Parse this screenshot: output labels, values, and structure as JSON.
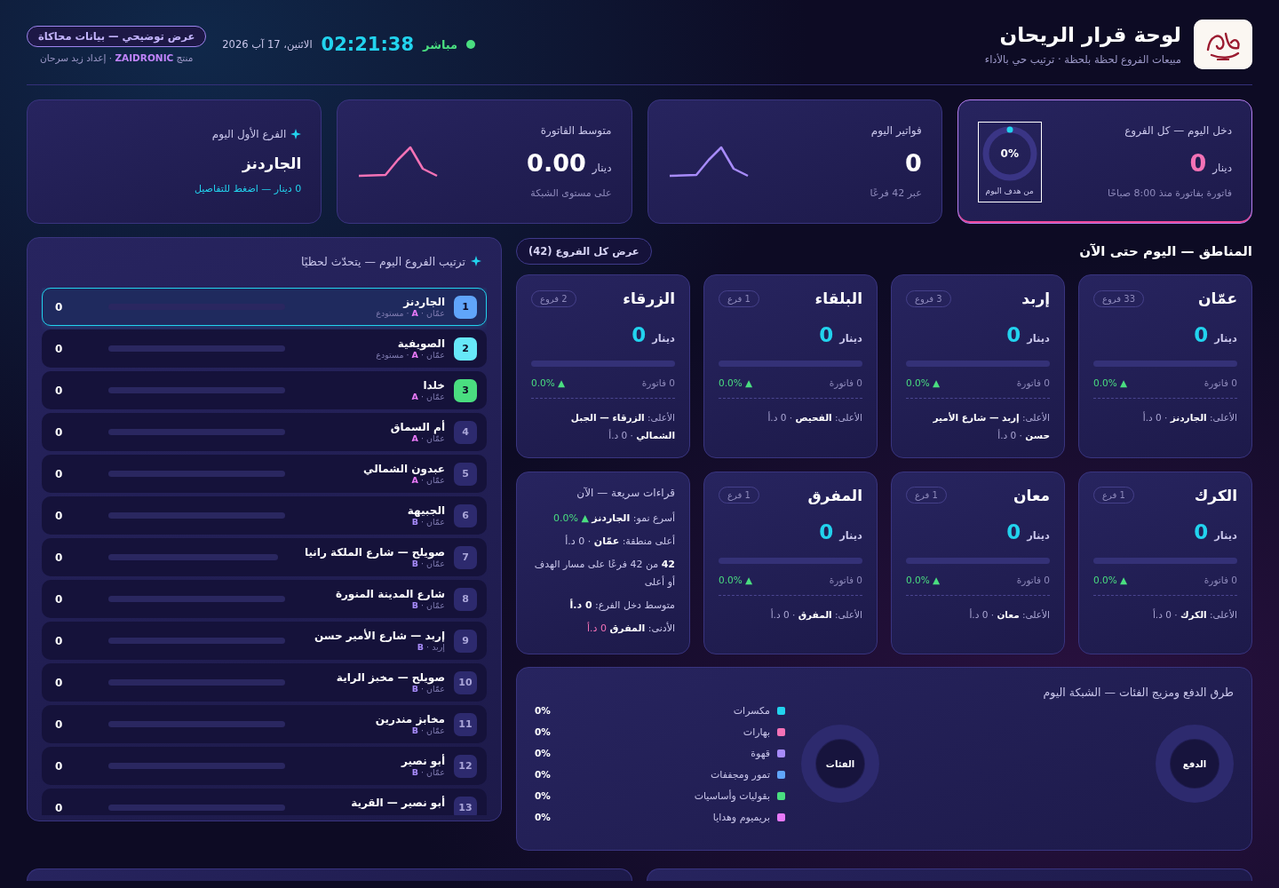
{
  "header": {
    "title": "لوحة قرار الريحان",
    "subtitle": "مبيعات الفروع لحظة بلحظة · ترتيب حي بالأداء",
    "live": true,
    "live_label": "مباشر",
    "time": "02:21:38",
    "date": "الاثنين، 17 آب 2026",
    "demo_badge": "عرض توضيحي — بيانات محاكاة",
    "credit": "منتج **ZAIDRONIC** · إعداد زيد سرحان"
  },
  "kpis": [
    {
      "kind": "ring",
      "highlighted": true,
      "title": "دخل اليوم — كل الفروع",
      "value": "0",
      "unit": "دينار",
      "note": "فاتورة بفاتورة منذ 8:00 صباحًا",
      "ring_label": "0%",
      "ring_caption": "من هدف اليوم",
      "level": 0
    },
    {
      "kind": "spark",
      "highlighted": false,
      "title": "فواتير اليوم",
      "value": "0",
      "note": "عبر 42 فرعًا",
      "color": "#a78bfa"
    },
    {
      "kind": "spark",
      "highlighted": false,
      "title": "متوسط الفاتورة",
      "value": "0.00",
      "unit": "دينار",
      "note": "على مستوى الشبكة",
      "color": "#f472b6"
    },
    {
      "kind": "leader",
      "highlighted": false,
      "title": "الفرع الأول اليوم",
      "value": "الجاردنز",
      "link": "0 دينار — اضغط للتفاصيل"
    }
  ],
  "ranking": {
    "title": "ترتيب الفروع اليوم — يتحدّث لحظيًا",
    "items": [
      {
        "rank": {
          "text": "1",
          "color": "#60a5fa"
        },
        "name": "الجاردنز",
        "meta": {
          "text": "عمّان · **A** · مستودع",
          "color": "#e879f9"
        },
        "value": "0",
        "selected": true
      },
      {
        "rank": {
          "text": "2",
          "color": "#67e8f9"
        },
        "name": "الصويفية",
        "meta": {
          "text": "عمّان · **A** · مستودع",
          "color": "#e879f9"
        },
        "value": "0",
        "selected": false
      },
      {
        "rank": {
          "text": "3",
          "color": "#4ade80"
        },
        "name": "خلدا",
        "meta": {
          "text": "عمّان · **A**",
          "color": "#e879f9"
        },
        "value": "0",
        "selected": false
      },
      {
        "rank": {
          "text": "4",
          "color": "#2d2a6e"
        },
        "name": "أم السماق",
        "meta": {
          "text": "عمّان · **A**",
          "color": "#e879f9"
        },
        "value": "0",
        "selected": false
      },
      {
        "rank": {
          "text": "5",
          "color": "#2d2a6e"
        },
        "name": "عبدون الشمالي",
        "meta": {
          "text": "عمّان · **A**",
          "color": "#e879f9"
        },
        "value": "0",
        "selected": false
      },
      {
        "rank": {
          "text": "6",
          "color": "#2d2a6e"
        },
        "name": "الجبيهة",
        "meta": {
          "text": "عمّان · **B**",
          "color": "#a78bfa"
        },
        "value": "0",
        "selected": false
      },
      {
        "rank": {
          "text": "7",
          "color": "#2d2a6e"
        },
        "name": "صويلح — شارع الملكة رانيا",
        "meta": {
          "text": "عمّان · **B**",
          "color": "#a78bfa"
        },
        "value": "0",
        "selected": false
      },
      {
        "rank": {
          "text": "8",
          "color": "#2d2a6e"
        },
        "name": "شارع المدينة المنورة",
        "meta": {
          "text": "عمّان · **B**",
          "color": "#a78bfa"
        },
        "value": "0",
        "selected": false
      },
      {
        "rank": {
          "text": "9",
          "color": "#2d2a6e"
        },
        "name": "إربد — شارع الأمير حسن",
        "meta": {
          "text": "إربد · **B**",
          "color": "#a78bfa"
        },
        "value": "0",
        "selected": false
      },
      {
        "rank": {
          "text": "10",
          "color": "#2d2a6e"
        },
        "name": "صويلح — مخبز الراية",
        "meta": {
          "text": "عمّان · **B**",
          "color": "#a78bfa"
        },
        "value": "0",
        "selected": false
      },
      {
        "rank": {
          "text": "11",
          "color": "#2d2a6e"
        },
        "name": "مخابز مندرين",
        "meta": {
          "text": "عمّان · **B**",
          "color": "#a78bfa"
        },
        "value": "0",
        "selected": false
      },
      {
        "rank": {
          "text": "12",
          "color": "#2d2a6e"
        },
        "name": "أبو نصير",
        "meta": {
          "text": "عمّان · **B**",
          "color": "#a78bfa"
        },
        "value": "0",
        "selected": false
      },
      {
        "rank": {
          "text": "13",
          "color": "#2d2a6e"
        },
        "name": "أبو نصير — القرية",
        "value": "0",
        "selected": false
      }
    ]
  },
  "regions": {
    "title": "المناطق — اليوم حتى الآن",
    "view_all": "عرض كل الفروع (42)",
    "cards": [
      {
        "name": "عمّان",
        "branches": "33 فروع",
        "unit": "دينار",
        "value": "0",
        "invoices": "0 فاتورة",
        "change": "▲ 0.0%",
        "top": "الأعلى: **الجاردنز** · 0 د.أ"
      },
      {
        "name": "إربد",
        "branches": "3 فروع",
        "unit": "دينار",
        "value": "0",
        "invoices": "0 فاتورة",
        "change": "▲ 0.0%",
        "top": "الأعلى: **إربد — شارع الأمير حسن** · 0 د.أ"
      },
      {
        "name": "البلقاء",
        "branches": "1 فرع",
        "unit": "دينار",
        "value": "0",
        "invoices": "0 فاتورة",
        "change": "▲ 0.0%",
        "top": "الأعلى: **الفحيص** · 0 د.أ"
      },
      {
        "name": "الزرقاء",
        "branches": "2 فروع",
        "unit": "دينار",
        "value": "0",
        "invoices": "0 فاتورة",
        "change": "▲ 0.0%",
        "top": "الأعلى: **الزرقاء — الجبل الشمالي** · 0 د.أ"
      },
      {
        "name": "الكرك",
        "branches": "1 فرع",
        "unit": "دينار",
        "value": "0",
        "invoices": "0 فاتورة",
        "change": "▲ 0.0%",
        "top": "الأعلى: **الكرك** · 0 د.أ"
      },
      {
        "name": "معان",
        "branches": "1 فرع",
        "unit": "دينار",
        "value": "0",
        "invoices": "0 فاتورة",
        "change": "▲ 0.0%",
        "top": "الأعلى: **معان** · 0 د.أ"
      },
      {
        "name": "المفرق",
        "branches": "1 فرع",
        "unit": "دينار",
        "value": "0",
        "invoices": "0 فاتورة",
        "change": "▲ 0.0%",
        "top": "الأعلى: **المفرق** · 0 د.أ"
      }
    ]
  },
  "quick": {
    "title": "قراءات سريعة — الآن",
    "lines": [
      {
        "text": "أسرع نمو: **الجاردنز**",
        "tail": "▲ %0.0",
        "color": "#4ade80"
      },
      {
        "text": "أعلى منطقة: **عمّان** · 0 د.أ"
      },
      {
        "text": "**42** من 42 فرعًا على مسار الهدف أو أعلى"
      },
      {
        "text": "متوسط دخل الفرع: **0 د.أ**"
      },
      {
        "text": "الأدنى: **المفرق**",
        "tail": "0 د.أ",
        "color": "#f472b6"
      }
    ]
  },
  "payments": {
    "title": "طرق الدفع ومزيج الفئات — الشبكة اليوم",
    "payment_donut": "الدفع",
    "category_donut": "الفئات",
    "legend": [
      {
        "label": "مكسرات",
        "value": "0%",
        "color": "#22d3ee"
      },
      {
        "label": "بهارات",
        "value": "0%",
        "color": "#f472b6"
      },
      {
        "label": "قهوة",
        "value": "0%",
        "color": "#a78bfa"
      },
      {
        "label": "تمور ومجففات",
        "value": "0%",
        "color": "#60a5fa"
      },
      {
        "label": "بقوليات وأساسيات",
        "value": "0%",
        "color": "#4ade80"
      },
      {
        "label": "بريميوم وهدايا",
        "value": "0%",
        "color": "#e879f9"
      }
    ]
  }
}
